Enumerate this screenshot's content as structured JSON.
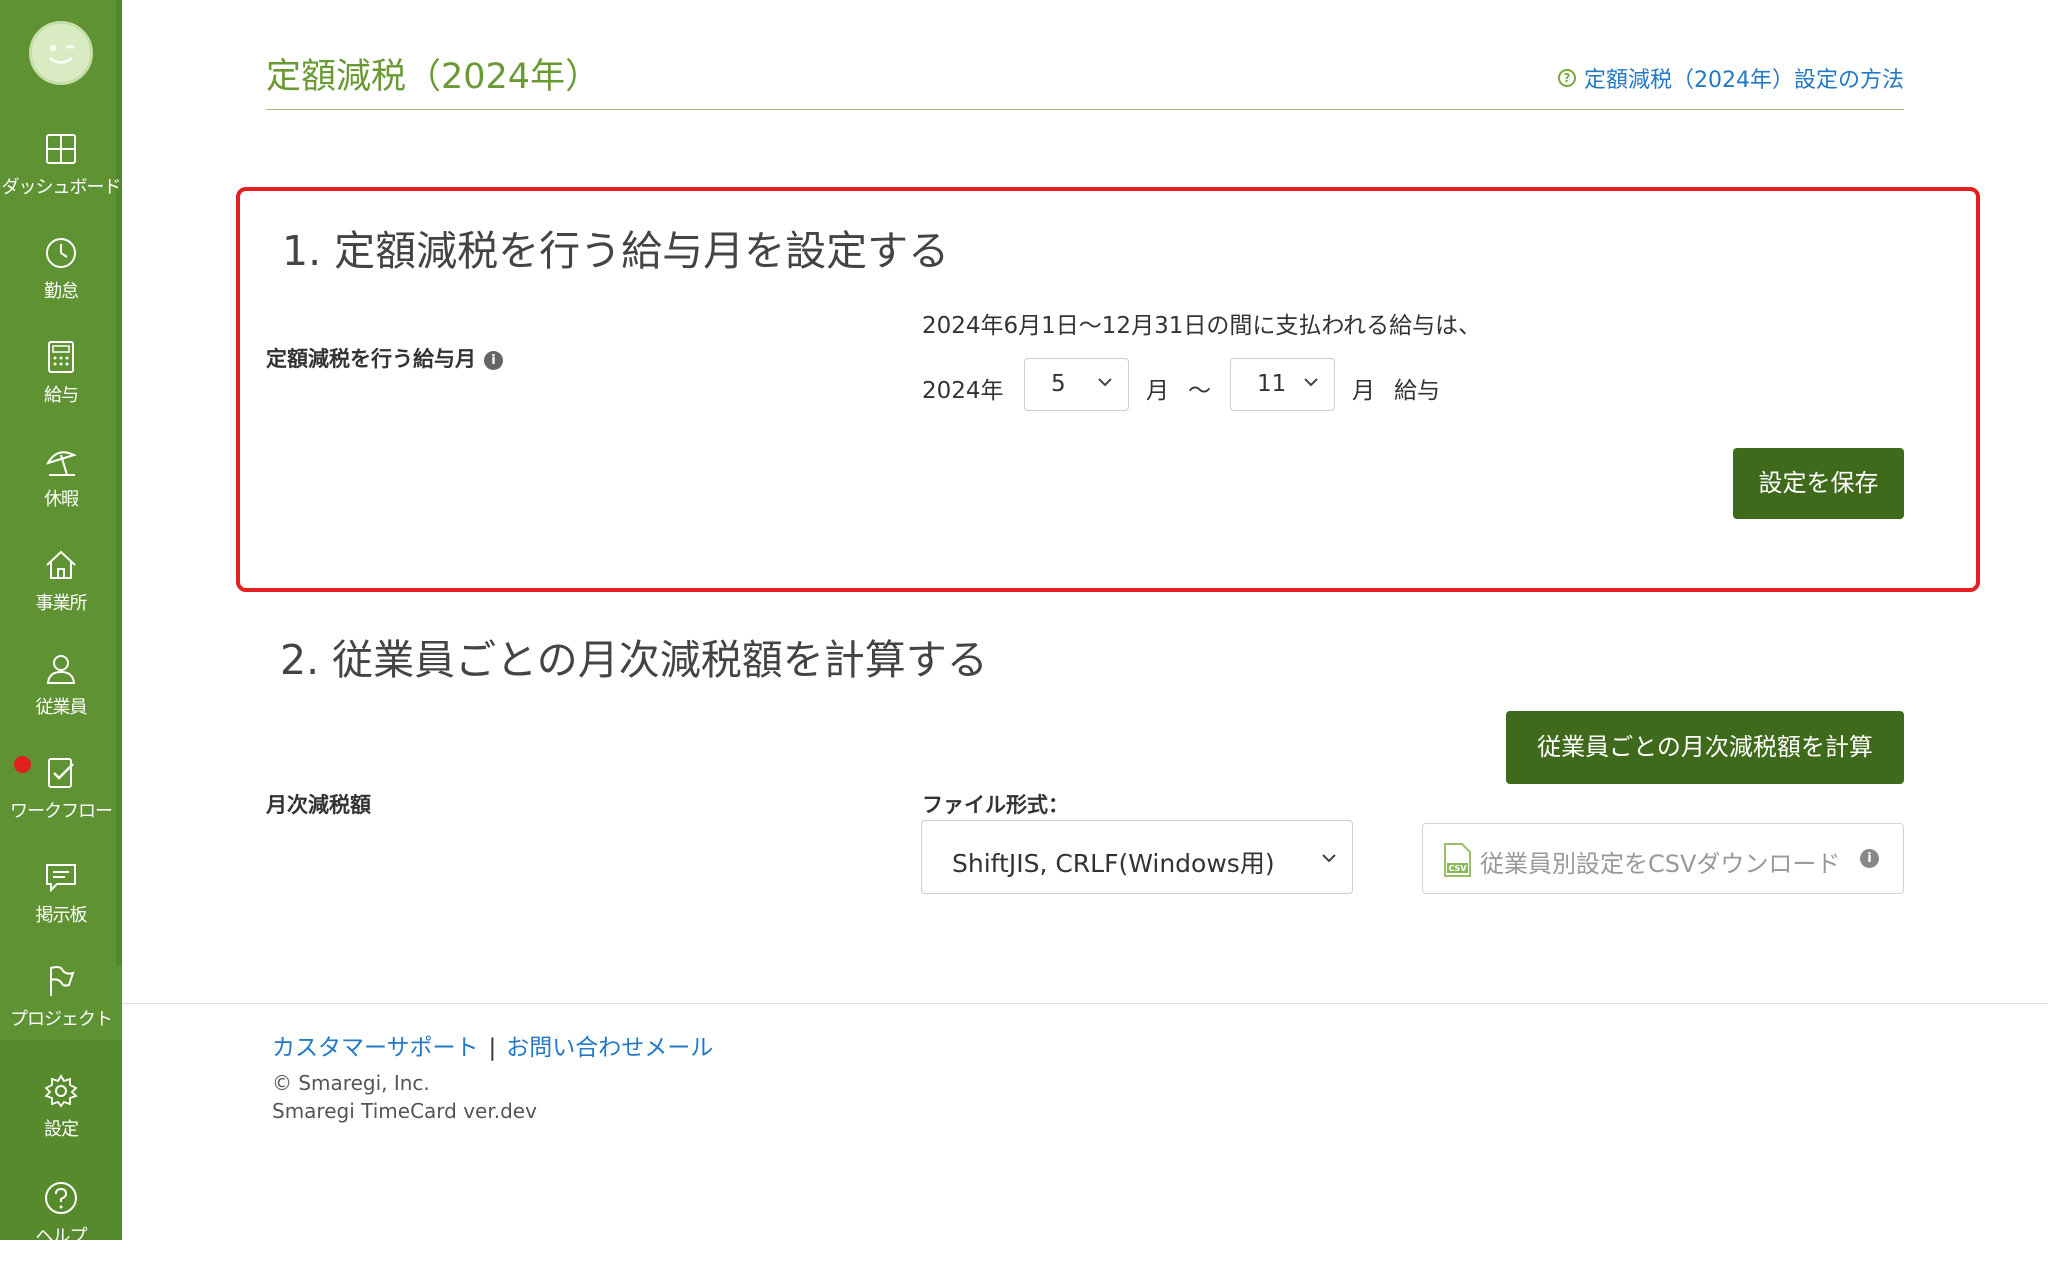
{
  "sidebar": {
    "items": [
      {
        "label": "ダッシュボード",
        "icon": "dashboard-icon"
      },
      {
        "label": "勤怠",
        "icon": "clock-icon"
      },
      {
        "label": "給与",
        "icon": "calculator-icon"
      },
      {
        "label": "休暇",
        "icon": "beach-umbrella-icon"
      },
      {
        "label": "事業所",
        "icon": "home-icon"
      },
      {
        "label": "従業員",
        "icon": "user-icon"
      },
      {
        "label": "ワークフロー",
        "icon": "checklist-icon"
      },
      {
        "label": "掲示板",
        "icon": "chat-icon"
      },
      {
        "label": "プロジェクト",
        "icon": "flag-icon"
      },
      {
        "label": "設定",
        "icon": "gear-icon"
      },
      {
        "label": "ヘルプ",
        "icon": "help-icon"
      }
    ]
  },
  "header": {
    "title": "定額減税（2024年）",
    "help_link": "定額減税（2024年）設定の方法"
  },
  "section1": {
    "title": "1. 定額減税を行う給与月を設定する",
    "label": "定額減税を行う給与月",
    "description": "2024年6月1日〜12月31日の間に支払われる給与は、",
    "year": "2024年",
    "start_month": "5",
    "month_unit": "月",
    "tilde": "〜",
    "end_month": "11",
    "month_unit2": "月",
    "salary": "給与",
    "save_button": "設定を保存"
  },
  "section2": {
    "title": "2. 従業員ごとの月次減税額を計算する",
    "calc_button": "従業員ごとの月次減税額を計算",
    "label": "月次減税額",
    "file_format_label": "ファイル形式：",
    "file_format_value": "ShiftJIS, CRLF(Windows用)",
    "csv_button": "従業員別設定をCSVダウンロード"
  },
  "footer": {
    "support_link": "カスタマーサポート",
    "separator": "|",
    "contact_link": "お問い合わせメール",
    "copyright": "© Smaregi, Inc.",
    "version": "Smaregi TimeCard ver.dev"
  },
  "colors": {
    "sidebar": "#5f9232",
    "title_green": "#6a9a35",
    "button_green": "#3f6a1c",
    "link_blue": "#2478c4",
    "highlight_red": "#e51f1f"
  }
}
